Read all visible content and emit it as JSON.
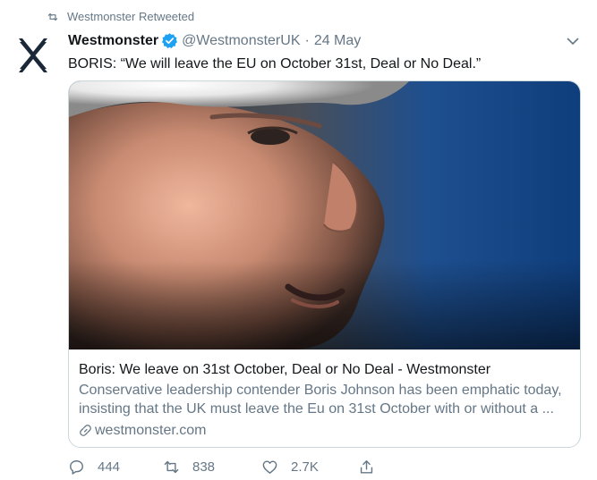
{
  "retweet_line": {
    "icon": "retweet-icon",
    "text": "Westmonster Retweeted"
  },
  "author": {
    "display_name": "Westmonster",
    "verified_icon": "verified-badge-icon",
    "handle": "@WestmonsterUK",
    "separator": "·",
    "date": "24 May",
    "avatar_icon": "westmonster-logo"
  },
  "menu_icon": "chevron-down-icon",
  "tweet_text": "BORIS: “We will leave the EU on October 31st, Deal or No Deal.”",
  "card": {
    "image": "photo-close-up-face",
    "title": "Boris: We leave on 31st October, Deal or No Deal - Westmonster",
    "description": "Conservative leadership contender Boris Johnson has been emphatic today, insisting that the UK must leave the Eu on 31st October with or without a ...",
    "link_icon": "link-icon",
    "domain": "westmonster.com"
  },
  "actions": {
    "reply_count": "444",
    "retweet_count": "838",
    "like_count": "2.7K",
    "share_icon": "share-icon"
  },
  "colors": {
    "primary_text": "#14171a",
    "secondary_text": "#657786",
    "verified_blue": "#1da1f2",
    "card_border": "#ccd6dd",
    "photo_background_blue": "#1e4f8f"
  }
}
